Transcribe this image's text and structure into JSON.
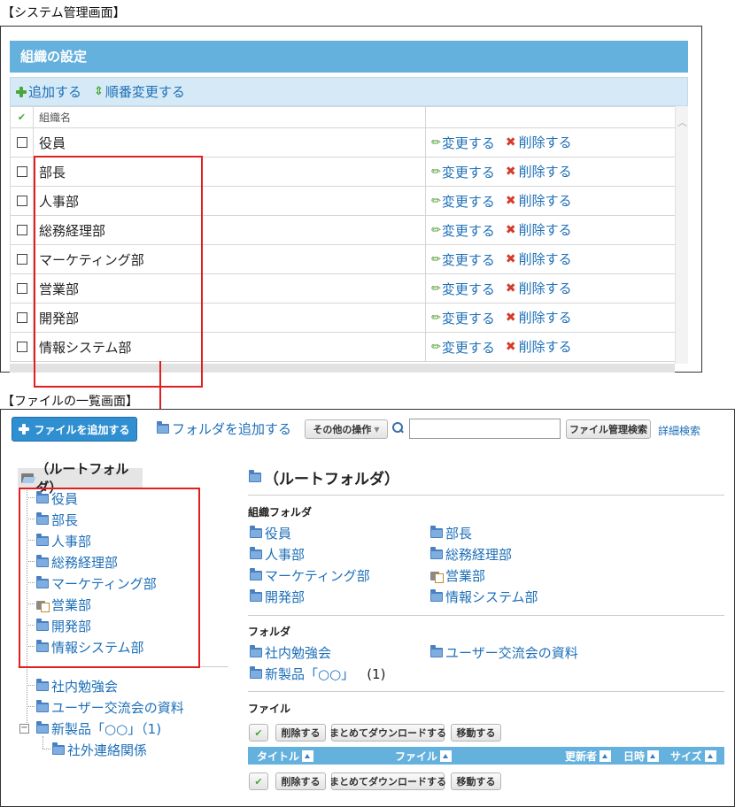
{
  "captions": {
    "system_screen": "【システム管理画面】",
    "file_list_screen": "【ファイルの一覧画面】"
  },
  "system_panel": {
    "title": "組織の設定",
    "toolbar": {
      "add_label": "追加する",
      "reorder_label": "順番変更する"
    },
    "table": {
      "check_header": "✔",
      "name_header": "組織名",
      "rows": [
        {
          "name": "役員"
        },
        {
          "name": "部長"
        },
        {
          "name": "人事部"
        },
        {
          "name": "総務経理部"
        },
        {
          "name": "マーケティング部"
        },
        {
          "name": "営業部"
        },
        {
          "name": "開発部"
        },
        {
          "name": "情報システム部"
        }
      ],
      "edit_label": "変更する",
      "delete_label": "削除する"
    }
  },
  "file_panel": {
    "toolbar": {
      "add_file_label": "ファイルを追加する",
      "add_folder_label": "フォルダを追加する",
      "other_ops_label": "その他の操作",
      "search_placeholder": "",
      "file_search_label": "ファイル管理検索",
      "advanced_search_label": "詳細検索"
    },
    "tree": {
      "root_label": "（ルートフォルダ）",
      "org_folders": [
        "役員",
        "部長",
        "人事部",
        "総務経理部",
        "マーケティング部",
        "営業部",
        "開発部",
        "情報システム部"
      ],
      "folders": [
        "社内勉強会",
        "ユーザー交流会の資料",
        "新製品「○○」（1)"
      ],
      "subfolder": "社外連絡関係"
    },
    "content": {
      "title": "（ルートフォルダ）",
      "org_folder_heading": "組織フォルダ",
      "org_folders_left": [
        "役員",
        "人事部",
        "マーケティング部",
        "開発部"
      ],
      "org_folders_right": [
        "部長",
        "総務経理部",
        "営業部",
        "情報システム部"
      ],
      "folder_heading": "フォルダ",
      "folders_left": [
        "社内勉強会",
        "新製品「○○」"
      ],
      "folders_left_count": "(1)",
      "folders_right": [
        "ユーザー交流会の資料"
      ],
      "file_heading": "ファイル",
      "buttons": {
        "check": "✔",
        "delete": "削除する",
        "download": "まとめてダウンロードする",
        "move": "移動する"
      },
      "columns": {
        "title": "タイトル",
        "file": "ファイル",
        "updater": "更新者",
        "datetime": "日時",
        "size": "サイズ"
      }
    }
  },
  "colors": {
    "header_blue": "#64b1de",
    "link_blue": "#1d6fb8",
    "highlight_red": "#e02020",
    "add_green": "#4aa83a"
  }
}
